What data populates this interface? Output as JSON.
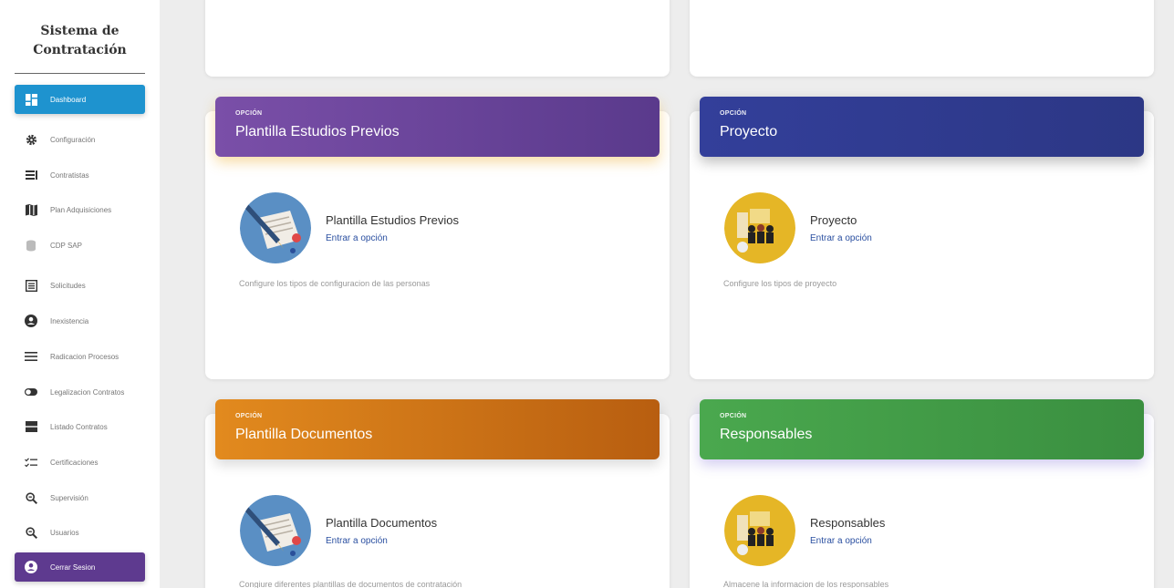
{
  "sidebar": {
    "brand": "Sistema de Contratación",
    "items": [
      {
        "label": "Dashboard",
        "icon": "dashboard-icon"
      },
      {
        "label": "Configuración",
        "icon": "gear-icon"
      },
      {
        "label": "Contratistas",
        "icon": "list-icon"
      },
      {
        "label": "Plan Adquisiciones",
        "icon": "map-icon"
      },
      {
        "label": "CDP SAP",
        "icon": "coins-icon"
      },
      {
        "label": "Solicitudes",
        "icon": "form-icon"
      },
      {
        "label": "Inexistencia",
        "icon": "user-circle-icon"
      },
      {
        "label": "Radicacion Procesos",
        "icon": "lines-icon"
      },
      {
        "label": "Legalizacion Contratos",
        "icon": "toggle-icon"
      },
      {
        "label": "Listado Contratos",
        "icon": "storage-icon"
      },
      {
        "label": "Certificaciones",
        "icon": "checklist-icon"
      },
      {
        "label": "Supervisión",
        "icon": "magnifier-icon"
      },
      {
        "label": "Usuarios",
        "icon": "magnifier-icon"
      }
    ],
    "logout": "Cerrar Sesion"
  },
  "cards": [
    {
      "overline": "OPCIÓN",
      "title": "Plantilla Estudios Previos",
      "name": "Plantilla Estudios Previos",
      "link": "Entrar a opción",
      "desc": "Configure los tipos de configuracion de las personas",
      "header_color": "#6a45a0"
    },
    {
      "overline": "OPCIÓN",
      "title": "Proyecto",
      "name": "Proyecto",
      "link": "Entrar a opción",
      "desc": "Configure los tipos de proyecto",
      "header_color": "#2f3a8f"
    },
    {
      "overline": "OPCIÓN",
      "title": "Plantilla Documentos",
      "name": "Plantilla Documentos",
      "link": "Entrar a opción",
      "desc": "Congiure diferentes plantillas de documentos de contratación",
      "header_color": "#cf7818"
    },
    {
      "overline": "OPCIÓN",
      "title": "Responsables",
      "name": "Responsables",
      "link": "Entrar a opción",
      "desc": "Almacene la informacion de los responsables",
      "header_color": "#43a047"
    }
  ]
}
